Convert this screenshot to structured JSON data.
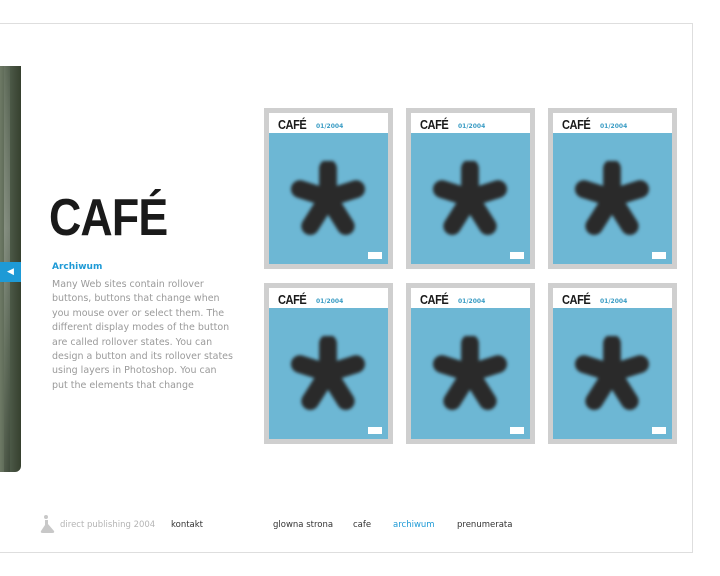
{
  "brand": {
    "logo_text": "CAFÉ"
  },
  "sidebar": {
    "section_title": "Archiwum",
    "intro": "Many Web sites contain rollover buttons, buttons that change when you mouse over or select them. The different display modes of the button are called rollover states. You can design a button and its rollover states using layers in Photoshop. You can put the elements that change",
    "tab_glyph": "◀"
  },
  "covers": [
    {
      "brand": "CAFÉ",
      "issue": "01/2004"
    },
    {
      "brand": "CAFÉ",
      "issue": "01/2004"
    },
    {
      "brand": "CAFÉ",
      "issue": "01/2004"
    },
    {
      "brand": "CAFÉ",
      "issue": "01/2004"
    },
    {
      "brand": "CAFÉ",
      "issue": "01/2004"
    },
    {
      "brand": "CAFÉ",
      "issue": "01/2004"
    }
  ],
  "footer": {
    "copyright": "direct publishing 2004",
    "contact": "kontakt",
    "nav": [
      "glowna strona",
      "cafe",
      "archiwum",
      "prenumerata"
    ],
    "active_nav": "archiwum"
  },
  "colors": {
    "accent": "#1e9ad6",
    "cover_bg": "#6db7d4",
    "cover_frame": "#cfcfcf",
    "text_gray": "#9a9a9a"
  },
  "icons": {
    "cover_star": "asterisk-icon",
    "footer_logo": "flask-logo-icon",
    "side_tab": "arrow-left-icon"
  }
}
